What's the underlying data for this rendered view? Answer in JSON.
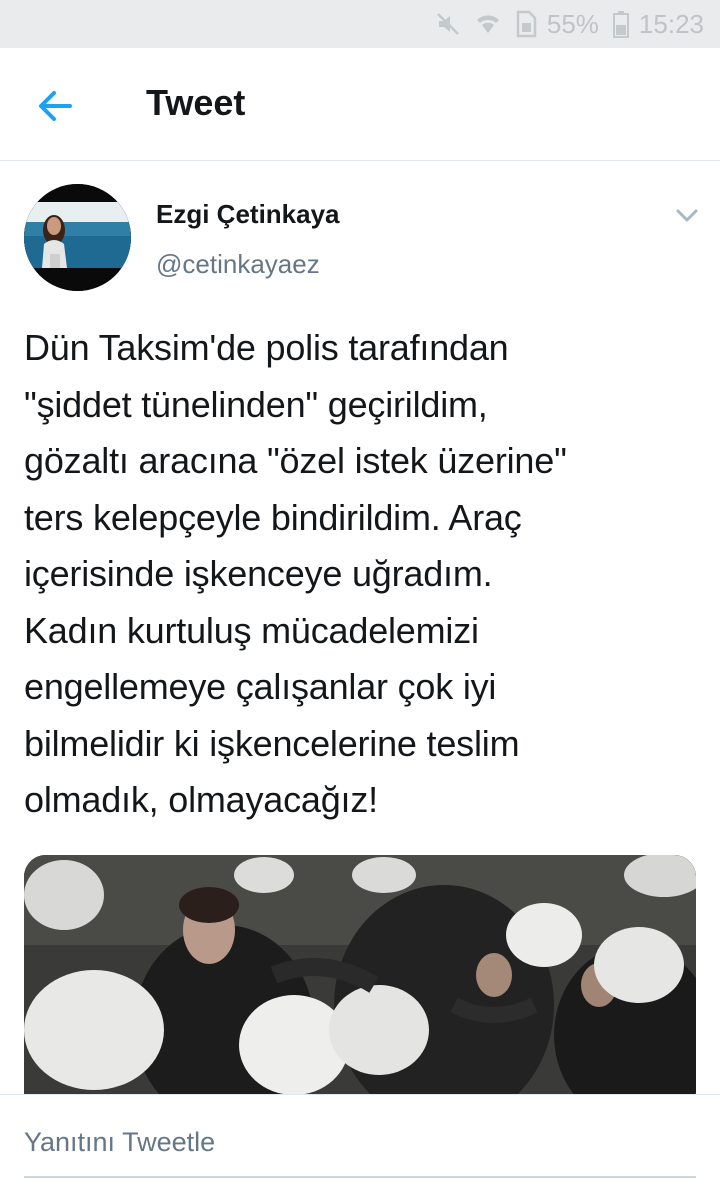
{
  "status_bar": {
    "battery_percent": "55%",
    "time": "15:23",
    "icons": [
      "mute-icon",
      "wifi-icon",
      "sim-icon",
      "battery-icon"
    ]
  },
  "header": {
    "title": "Tweet",
    "back_icon": "arrow-left-icon"
  },
  "tweet": {
    "author_name": "Ezgi Çetinkaya",
    "author_handle": "@cetinkayaez",
    "text": "Dün Taksim'de polis tarafından\n\"şiddet tünelinden\" geçirildim,\ngözaltı aracına \"özel istek üzerine\"\nters kelepçeyle bindirildim. Araç\niçerisinde işkenceye uğradım.\nKadın kurtuluş mücadelemizi\nengellemeye çalışanlar çok iyi\nbilmelidir ki işkencelerine teslim\nolmadık, olmayacağız!",
    "media_icon": "photo-image"
  },
  "reply": {
    "placeholder": "Yanıtını Tweetle"
  },
  "colors": {
    "accent": "#1da1f2",
    "secondary_text": "#657786",
    "primary_text": "#14171a",
    "divider": "#e1e8ed",
    "status_bar_bg": "#e9ebec"
  }
}
